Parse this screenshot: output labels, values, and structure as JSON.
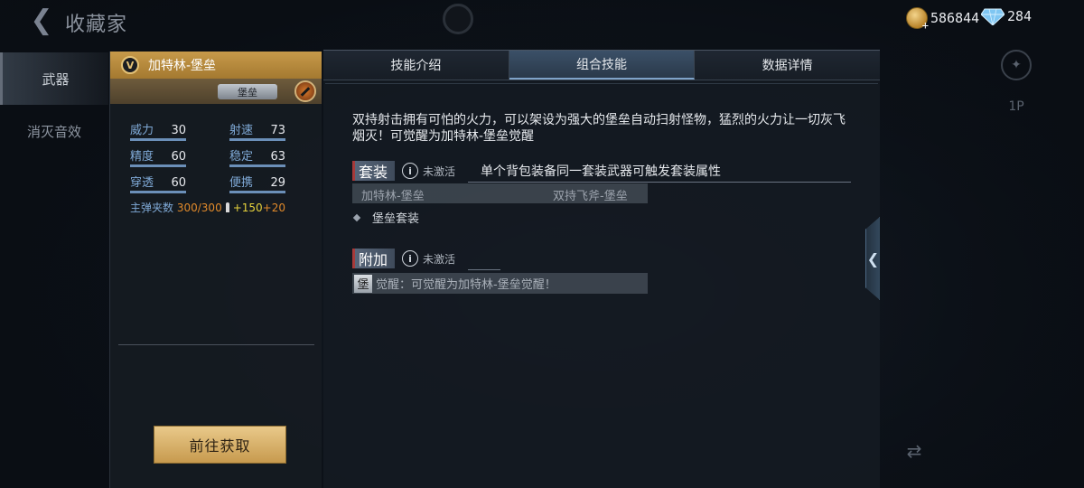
{
  "app": {
    "title": "收藏家"
  },
  "currency": {
    "gold": "586844",
    "diamonds": "284"
  },
  "side_nav": {
    "items": [
      {
        "label": "武器",
        "active": true
      },
      {
        "label": "消灭音效",
        "active": false
      }
    ]
  },
  "right_icons": {
    "player_label": "1P"
  },
  "weapon": {
    "name": "加特林-堡垒",
    "rank_badge": "V",
    "tag": "堡垒",
    "stats": [
      {
        "label": "威力",
        "value": "30"
      },
      {
        "label": "射速",
        "value": "73"
      },
      {
        "label": "精度",
        "value": "60"
      },
      {
        "label": "稳定",
        "value": "63"
      },
      {
        "label": "穿透",
        "value": "60"
      },
      {
        "label": "便携",
        "value": "29"
      }
    ],
    "ammo": {
      "label": "主弹夹数",
      "current": "300",
      "separator": "/",
      "max": "300",
      "bonus1": "+150",
      "bonus2": "+20"
    },
    "acquire_label": "前往获取"
  },
  "tabs": [
    {
      "label": "技能介绍",
      "active": false
    },
    {
      "label": "组合技能",
      "active": true
    },
    {
      "label": "数据详情",
      "active": false
    }
  ],
  "combo": {
    "description": "双持射击拥有可怕的火力，可以架设为强大的堡垒自动扫射怪物，猛烈的火力让一切灰飞烟灭！可觉醒为加特林-堡垒觉醒",
    "set": {
      "title": "套装",
      "status": "未激活",
      "note": "单个背包装备同一套装武器可触发套装属性",
      "items": [
        "加特林-堡垒",
        "双持飞斧-堡垒"
      ],
      "bonus": "堡垒套装"
    },
    "extra": {
      "title": "附加",
      "status": "未激活",
      "icon_char": "堡",
      "awaken_text": "觉醒：可觉醒为加特林-堡垒觉醒！"
    }
  },
  "colors": {
    "gold_accent": "#c79a4a",
    "active_tab": "#3b5068",
    "stat_label": "#7fa9d6",
    "ammo_orange": "#e0892a",
    "ammo_yellow": "#e6d23c"
  }
}
